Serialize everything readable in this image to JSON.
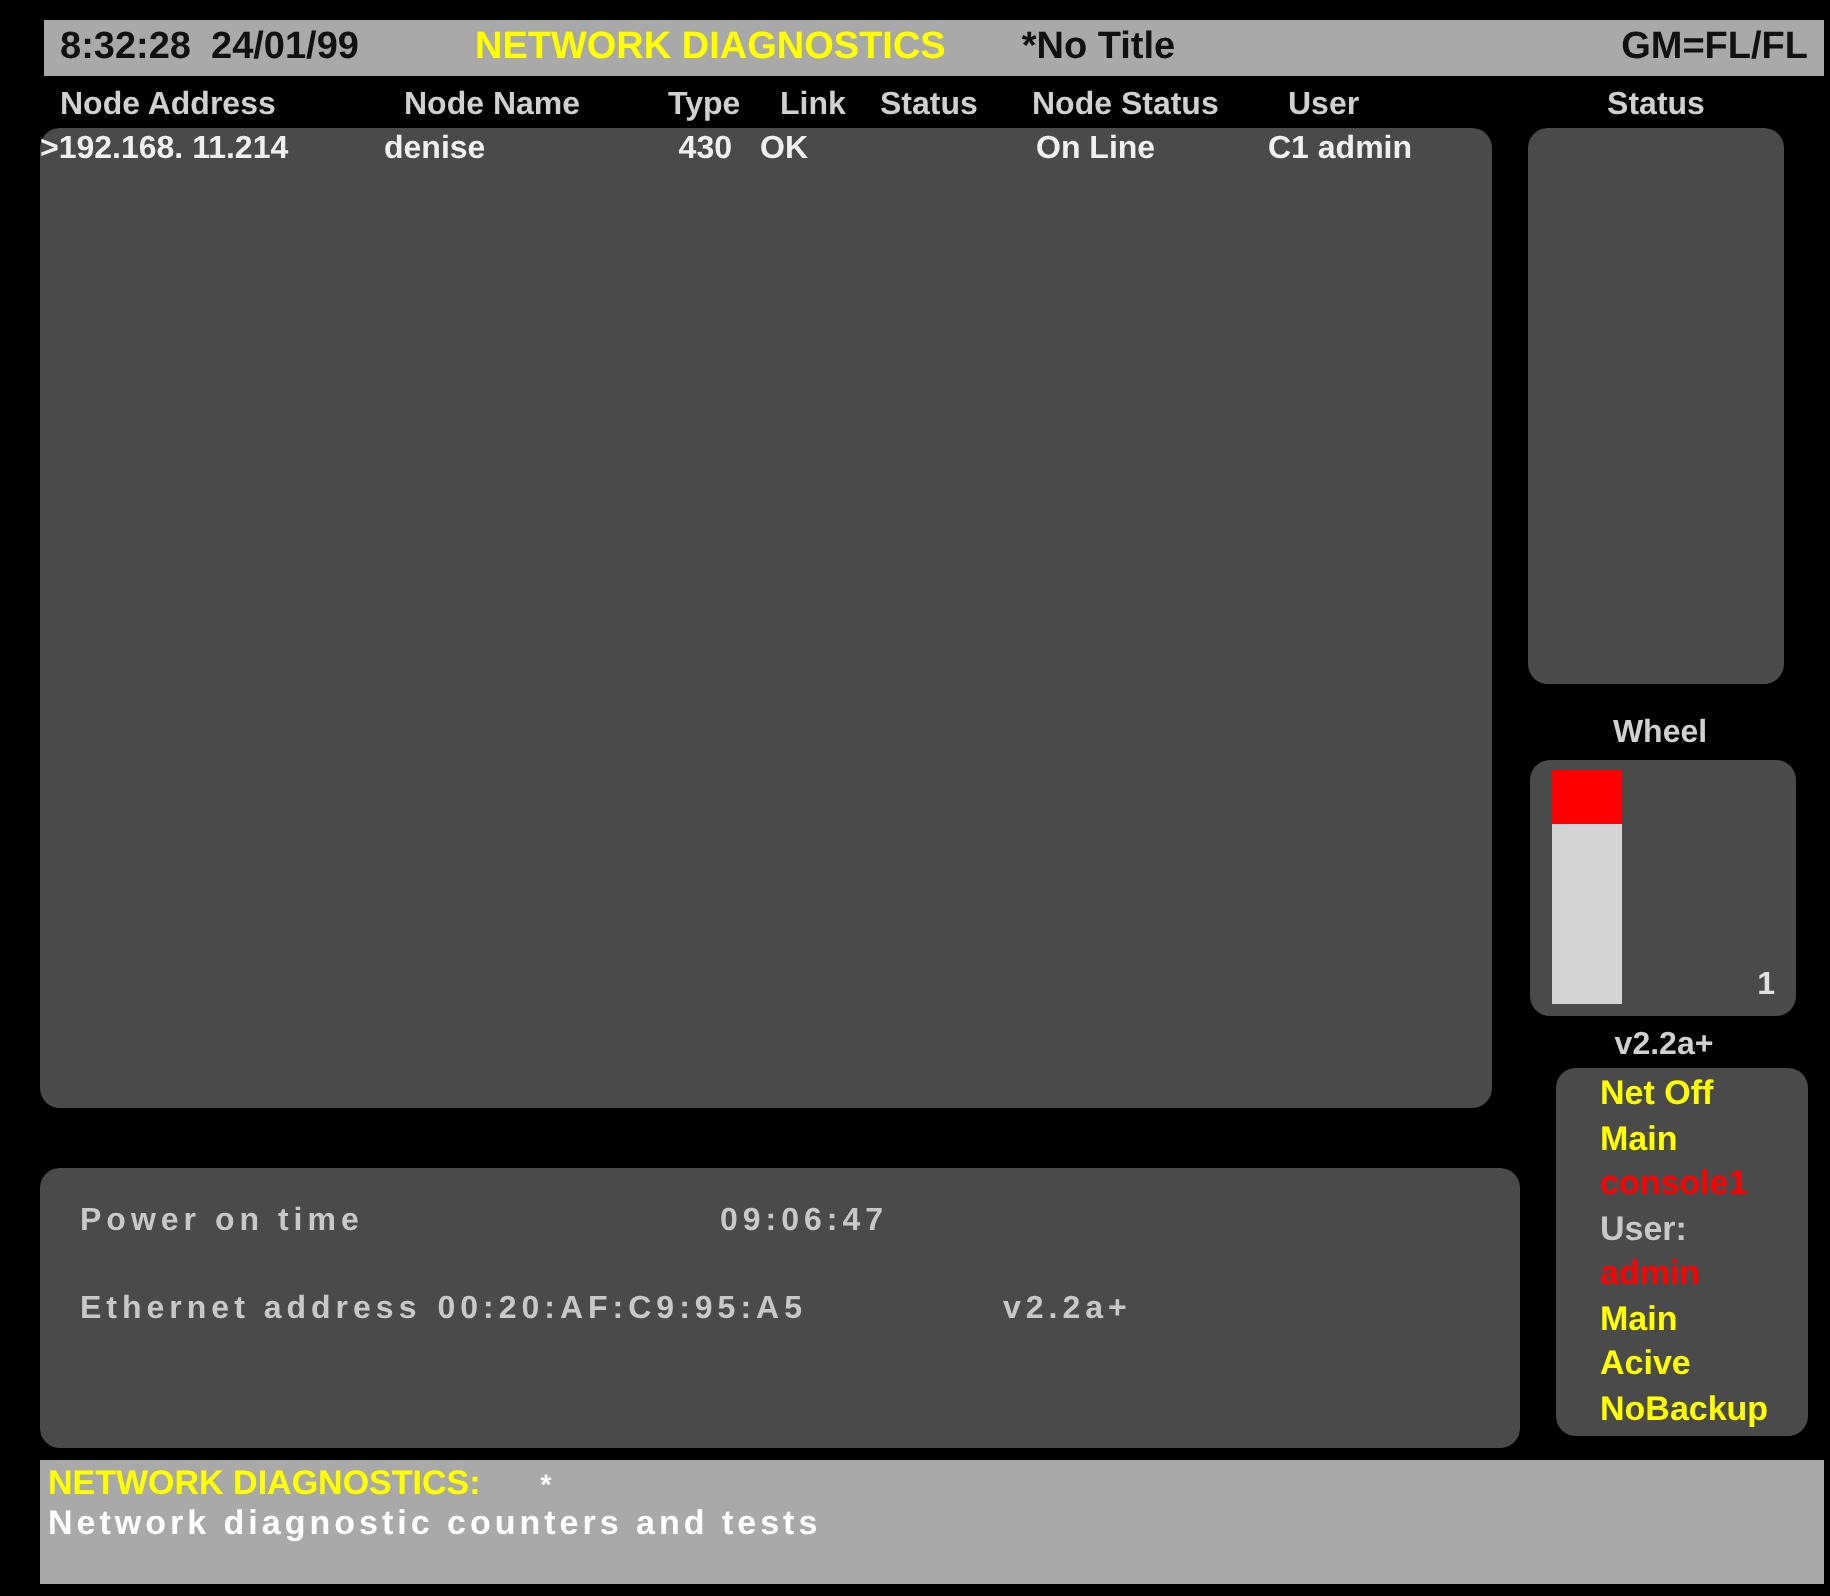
{
  "header": {
    "clock": "8:32:28",
    "date": "24/01/99",
    "title": "NETWORK DIAGNOSTICS",
    "show": "*No Title",
    "mode": "GM=FL/FL"
  },
  "table": {
    "columns": [
      "Node Address",
      "Node Name",
      "Type",
      "Link",
      "Status",
      "Node Status",
      "User"
    ],
    "rows": [
      {
        "cells": [
          ">192.168.  11.214",
          "denise",
          "430",
          "OK",
          "",
          "On Line",
          "C1 admin"
        ]
      }
    ]
  },
  "status_panel": {
    "title": "Status"
  },
  "wheel": {
    "title": "Wheel",
    "level": 0.77,
    "reading": "1"
  },
  "version": "v2.2a+",
  "info": [
    {
      "text": "Net Off",
      "color": "#ffff00"
    },
    {
      "text": "Main",
      "color": "#ffff00"
    },
    {
      "text": "console1",
      "color": "#ff0000"
    },
    {
      "text": "User:",
      "color": "#c8c8c8"
    },
    {
      "text": "admin",
      "color": "#ff0000"
    },
    {
      "text": "Main",
      "color": "#ffff00"
    },
    {
      "text": "Acive",
      "color": "#ffff00"
    },
    {
      "text": "NoBackup",
      "color": "#ffff00"
    }
  ],
  "details": [
    {
      "label": "Power on time",
      "value": "09:06:47"
    },
    {
      "label": "Ethernet address",
      "value": "00:20:AF:C9:95:A5",
      "extra": "v2.2a+"
    }
  ],
  "footer": {
    "heading": "NETWORK DIAGNOSTICS:",
    "mark": "*",
    "description": "Network diagnostic counters and tests"
  }
}
